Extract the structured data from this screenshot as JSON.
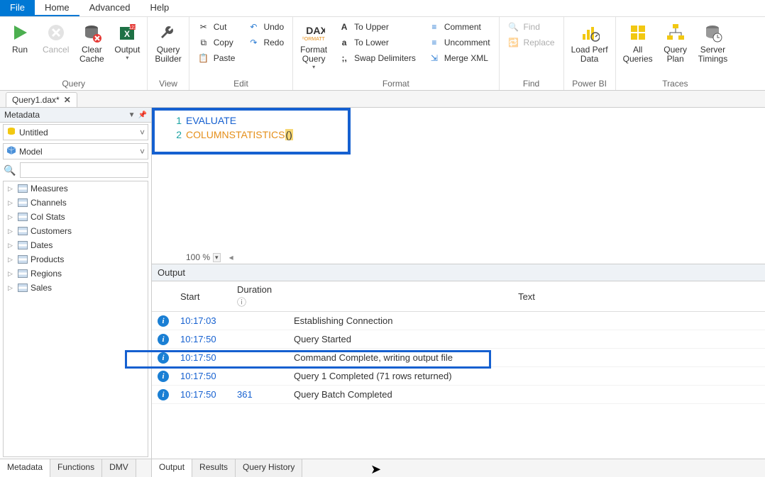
{
  "menu": {
    "file": "File",
    "home": "Home",
    "advanced": "Advanced",
    "help": "Help"
  },
  "ribbon": {
    "query": {
      "label": "Query",
      "run": "Run",
      "cancel": "Cancel",
      "clear_cache": "Clear\nCache",
      "output": "Output"
    },
    "view": {
      "label": "View",
      "builder": "Query\nBuilder"
    },
    "edit": {
      "label": "Edit",
      "cut": "Cut",
      "copy": "Copy",
      "paste": "Paste",
      "undo": "Undo",
      "redo": "Redo"
    },
    "format": {
      "label": "Format",
      "dax": "Format\nQuery",
      "upper": "To Upper",
      "lower": "To Lower",
      "swap": "Swap Delimiters",
      "comment": "Comment",
      "uncomment": "Uncomment",
      "merge": "Merge XML"
    },
    "find": {
      "label": "Find",
      "find": "Find",
      "replace": "Replace"
    },
    "powerbi": {
      "label": "Power BI",
      "load": "Load Perf\nData"
    },
    "traces": {
      "label": "Traces",
      "all": "All\nQueries",
      "plan": "Query\nPlan",
      "timing": "Server\nTimings"
    }
  },
  "doc_tab": {
    "name": "Query1.dax*"
  },
  "metadata": {
    "title": "Metadata",
    "db": "Untitled",
    "model": "Model",
    "tables": [
      "Measures",
      "Channels",
      "Col Stats",
      "Customers",
      "Dates",
      "Products",
      "Regions",
      "Sales"
    ]
  },
  "editor": {
    "lines": [
      {
        "n": "1",
        "kw": "EVALUATE"
      },
      {
        "n": "2",
        "fn": "COLUMNSTATISTICS",
        "pn": "()"
      }
    ],
    "zoom": "100 %"
  },
  "output": {
    "title": "Output",
    "cols": {
      "start": "Start",
      "duration": "Duration",
      "text": "Text"
    },
    "rows": [
      {
        "start": "10:17:03",
        "dur": "",
        "text": "Establishing Connection"
      },
      {
        "start": "10:17:50",
        "dur": "",
        "text": "Query Started"
      },
      {
        "start": "10:17:50",
        "dur": "",
        "text": "Command Complete, writing output file"
      },
      {
        "start": "10:17:50",
        "dur": "",
        "text": "Query 1 Completed (71 rows returned)"
      },
      {
        "start": "10:17:50",
        "dur": "361",
        "text": "Query Batch Completed"
      }
    ]
  },
  "bottom": {
    "metadata": "Metadata",
    "functions": "Functions",
    "dmv": "DMV",
    "output": "Output",
    "results": "Results",
    "history": "Query History"
  }
}
